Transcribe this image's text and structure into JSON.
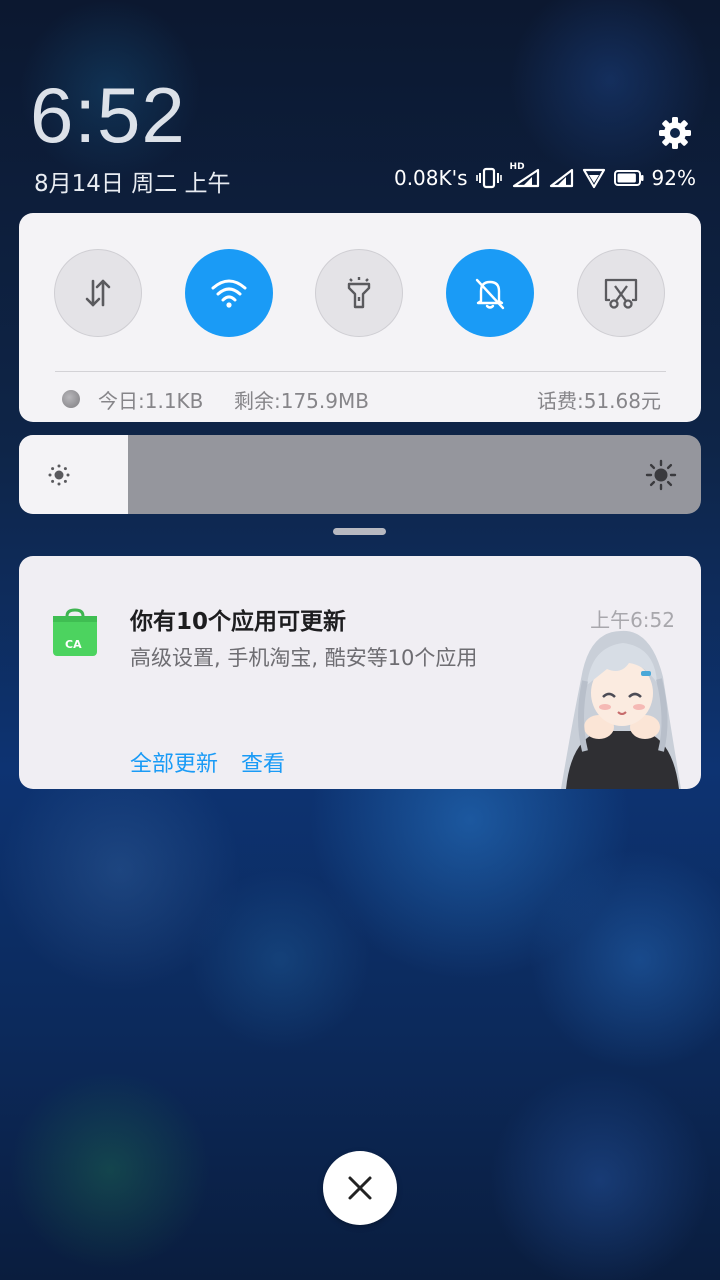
{
  "header": {
    "time": "6:52",
    "date": "8月14日 周二 上午",
    "settings_icon": "gear-icon"
  },
  "status_bar": {
    "net_speed": "0.08K's",
    "hd_label": "HD",
    "battery_level": 92,
    "battery_text": "92%",
    "icons": [
      "vibrate-icon",
      "signal-hd-icon",
      "signal-icon",
      "wifi-icon",
      "battery-icon"
    ]
  },
  "quick_settings": {
    "toggles": [
      {
        "name": "mobile-data",
        "icon": "data-arrows-icon",
        "on": false
      },
      {
        "name": "wifi",
        "icon": "wifi-icon",
        "on": true
      },
      {
        "name": "flashlight",
        "icon": "flashlight-icon",
        "on": false
      },
      {
        "name": "silent",
        "icon": "bell-off-icon",
        "on": true
      },
      {
        "name": "screenshot",
        "icon": "scissors-icon",
        "on": false
      }
    ],
    "today_usage": "今日:1.1KB",
    "remaining": "剩余:175.9MB",
    "balance": "话费:51.68元"
  },
  "brightness": {
    "level_percent": 16,
    "low_icon": "brightness-low-icon",
    "high_icon": "brightness-high-icon"
  },
  "notification": {
    "title": "你有10个应用可更新",
    "body": "高级设置, 手机淘宝, 酷安等10个应用",
    "time": "上午6:52",
    "app_icon": "app-store-bag-icon",
    "actions": {
      "update_all": "全部更新",
      "view": "查看"
    }
  },
  "colors": {
    "accent": "#1a9bf6",
    "card_bg": "#f4f3f6",
    "app_icon_green": "#4cd35f"
  },
  "close_icon": "close-icon"
}
